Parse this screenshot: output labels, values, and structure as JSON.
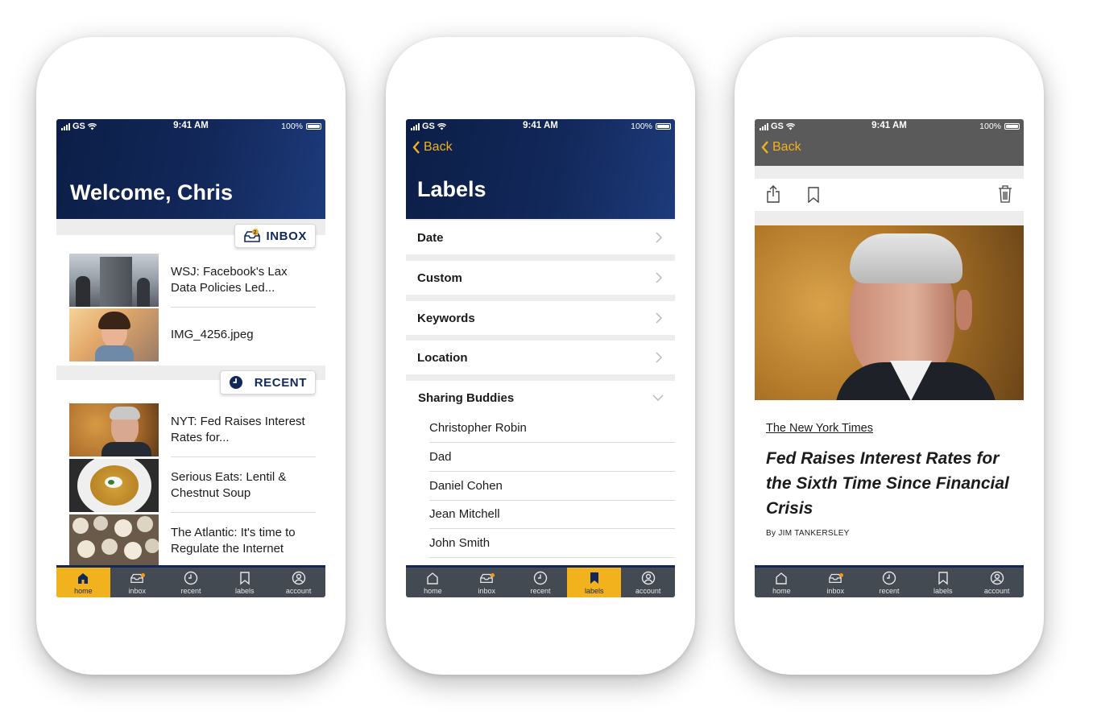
{
  "status": {
    "carrier": "GS",
    "time": "9:41 AM",
    "battery": "100%"
  },
  "tabs": [
    {
      "label": "home",
      "icon": "home-icon"
    },
    {
      "label": "inbox",
      "icon": "inbox-icon"
    },
    {
      "label": "recent",
      "icon": "clock-icon"
    },
    {
      "label": "labels",
      "icon": "bookmark-icon"
    },
    {
      "label": "account",
      "icon": "account-icon"
    }
  ],
  "home": {
    "title": "Welcome, Chris",
    "inbox": {
      "label": "INBOX",
      "badge": "2",
      "items": [
        {
          "text": "WSJ: Facebook's Lax Data Policies Led...",
          "thumb": "building-photo"
        },
        {
          "text": "IMG_4256.jpeg",
          "thumb": "selfie-photo"
        }
      ]
    },
    "recent": {
      "label": "RECENT",
      "items": [
        {
          "text": "NYT: Fed Raises Interest Rates for...",
          "thumb": "portrait-photo"
        },
        {
          "text": "Serious Eats: Lentil & Chestnut Soup",
          "thumb": "soup-photo"
        },
        {
          "text": "The Atlantic: It's time to Regulate the Internet",
          "thumb": "clocks-photo"
        }
      ]
    },
    "active_tab": "home"
  },
  "labels": {
    "back": "Back",
    "title": "Labels",
    "rows": [
      "Date",
      "Custom",
      "Keywords",
      "Location"
    ],
    "expanded": {
      "label": "Sharing Buddies",
      "items": [
        "Christopher Robin",
        "Dad",
        "Daniel Cohen",
        "Jean Mitchell",
        "John Smith"
      ]
    },
    "active_tab": "labels"
  },
  "article": {
    "back": "Back",
    "source": "The New York Times",
    "headline": "Fed Raises Interest Rates for the Sixth Time Since Financial Crisis",
    "byline": "By JIM TANKERSLEY",
    "actions": [
      "share-icon",
      "bookmark-icon",
      "trash-icon"
    ]
  },
  "colors": {
    "navy": "#12285a",
    "accent": "#f2b21e",
    "tabbar": "#444a52",
    "gray_header": "#5a5a5a"
  }
}
